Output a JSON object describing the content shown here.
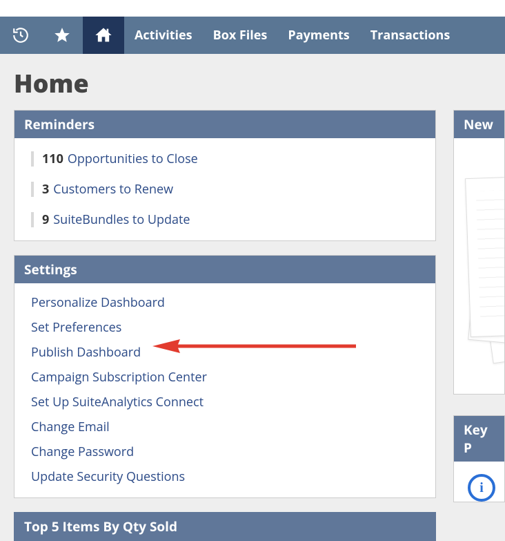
{
  "nav": {
    "items": [
      "Activities",
      "Box Files",
      "Payments",
      "Transactions"
    ]
  },
  "page": {
    "title": "Home"
  },
  "reminders": {
    "header": "Reminders",
    "items": [
      {
        "count": "110",
        "label": "Opportunities to Close"
      },
      {
        "count": "3",
        "label": "Customers to Renew"
      },
      {
        "count": "9",
        "label": "SuiteBundles to Update"
      }
    ]
  },
  "settings": {
    "header": "Settings",
    "items": [
      "Personalize Dashboard",
      "Set Preferences",
      "Publish Dashboard",
      "Campaign Subscription Center",
      "Set Up SuiteAnalytics Connect",
      "Change Email",
      "Change Password",
      "Update Security Questions"
    ]
  },
  "top5": {
    "header": "Top 5 Items By Qty Sold"
  },
  "rightPanels": {
    "new": "New ",
    "key": "Key P"
  }
}
